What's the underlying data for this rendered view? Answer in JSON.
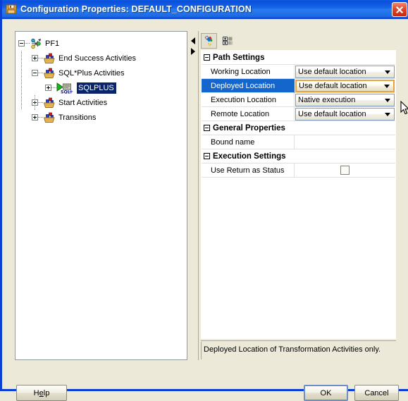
{
  "window": {
    "title": "Configuration Properties: DEFAULT_CONFIGURATION",
    "icon": "save-floppy-icon",
    "close_label": "Close",
    "titlebar_color": "#1666e8",
    "close_color": "#e2452a"
  },
  "tree": {
    "nodes": [
      {
        "label": "PF1",
        "icon": "process-flow-icon",
        "expander": "minus",
        "depth": 0,
        "selected": false
      },
      {
        "label": "End Success Activities",
        "icon": "folder-basket-icon",
        "expander": "plus",
        "depth": 1,
        "selected": false
      },
      {
        "label": "SQL*Plus Activities",
        "icon": "folder-basket-icon",
        "expander": "minus",
        "depth": 1,
        "selected": false
      },
      {
        "label": "SQLPLUS",
        "icon": "sqlplus-icon",
        "expander": "plus",
        "depth": 2,
        "selected": true
      },
      {
        "label": "Start Activities",
        "icon": "folder-basket-icon",
        "expander": "plus",
        "depth": 1,
        "selected": false
      },
      {
        "label": "Transitions",
        "icon": "folder-basket-icon",
        "expander": "plus",
        "depth": 1,
        "selected": false
      }
    ],
    "selection_color": "#0a246a"
  },
  "splitter": {
    "collapse_left_label": "Collapse left",
    "collapse_right_label": "Collapse right"
  },
  "properties": {
    "toolbar": [
      {
        "name": "categorized-view-button",
        "icon": "paintbrush-icon",
        "pressed": true
      },
      {
        "name": "alphabetic-sort-button",
        "icon": "grid-sort-icon",
        "pressed": false
      }
    ],
    "rows": [
      {
        "type": "category",
        "name": "Path Settings"
      },
      {
        "type": "property",
        "name": "Working Location",
        "editor": "combo",
        "value": "Use default location",
        "selected": false,
        "focused": false
      },
      {
        "type": "property",
        "name": "Deployed Location",
        "editor": "combo",
        "value": "Use default location",
        "selected": true,
        "focused": true
      },
      {
        "type": "property",
        "name": "Execution Location",
        "editor": "combo",
        "value": "Native execution",
        "selected": false,
        "focused": false
      },
      {
        "type": "property",
        "name": "Remote Location",
        "editor": "combo",
        "value": "Use default location",
        "selected": false,
        "focused": false
      },
      {
        "type": "category",
        "name": "General Properties"
      },
      {
        "type": "property",
        "name": "Bound name",
        "editor": "none",
        "value": "",
        "selected": false,
        "focused": false
      },
      {
        "type": "category",
        "name": "Execution Settings"
      },
      {
        "type": "property",
        "name": "Use Return as Status",
        "editor": "checkbox",
        "value": "",
        "checked": false,
        "selected": false,
        "focused": false
      }
    ],
    "selected_row_color": "#1466cc",
    "focused_editor_border_color": "#e8a33d",
    "description": "Deployed Location of Transformation Activities only."
  },
  "footer": {
    "help": {
      "label": "Help",
      "mnemonic": "e"
    },
    "ok": {
      "label": "OK",
      "default": true
    },
    "cancel": {
      "label": "Cancel"
    }
  }
}
